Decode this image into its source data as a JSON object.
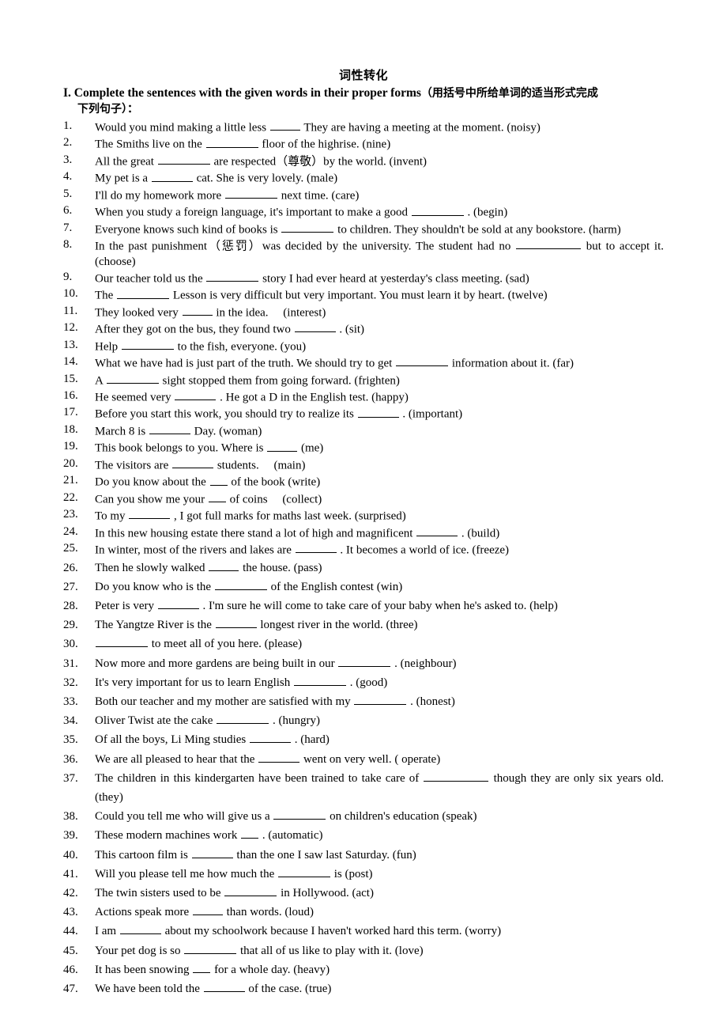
{
  "document": {
    "title": "词性转化",
    "section_heading": {
      "number": "I.",
      "english": "Complete the sentences with the given words in their proper forms",
      "chinese_line1": "（用括号中所给单词的适当形式完成",
      "chinese_line2": "下列句子）："
    }
  },
  "questions": [
    {
      "num": "1.",
      "pre": "Would you mind making a little less",
      "blank": "b-s",
      "post": "They are having a meeting at the moment. (noisy)",
      "justify": false
    },
    {
      "num": "2.",
      "pre": "The Smiths live on the",
      "blank": "b-l",
      "post": "floor of the highrise. (nine)",
      "justify": false
    },
    {
      "num": "3.",
      "pre": "All the great",
      "blank": "b-l",
      "post": "are respected（尊敬）by the world. (invent)",
      "justify": false
    },
    {
      "num": "4.",
      "pre": "My pet is a",
      "blank": "b-m",
      "post": "cat. She is very lovely. (male)",
      "justify": false
    },
    {
      "num": "5.",
      "pre": "I'll do my homework more",
      "blank": "b-l",
      "post": "next time. (care)",
      "justify": false
    },
    {
      "num": "6.",
      "pre": "When you study a foreign language, it's important to make a good",
      "blank": "b-l",
      "post": ". (begin)",
      "justify": false
    },
    {
      "num": "7.",
      "pre": "Everyone knows such kind of books is",
      "blank": "b-l",
      "post": "to children. They shouldn't be sold at any bookstore. (harm)",
      "justify": true
    },
    {
      "num": "8.",
      "pre": "In the past punishment（惩罚）was decided by the university. The student had no",
      "blank": "b-xl",
      "post": "but to accept it. (choose)",
      "justify": true
    },
    {
      "num": "9.",
      "pre": "Our teacher told us the",
      "blank": "b-l",
      "post": "story I had ever heard at yesterday's class meeting. (sad)",
      "justify": false
    },
    {
      "num": "10.",
      "pre": "The",
      "blank": "b-l",
      "post": "Lesson is very difficult but very important. You must learn it by heart. (twelve)",
      "justify": false
    },
    {
      "num": "11.",
      "pre": "They looked very",
      "blank": "b-s",
      "post": "in the idea.　 (interest)",
      "justify": false
    },
    {
      "num": "12.",
      "pre": "After they got on the bus, they found two",
      "blank": "b-m",
      "post": ". (sit)",
      "justify": false
    },
    {
      "num": "13.",
      "pre": "Help",
      "blank": "b-l",
      "post": "to the fish, everyone. (you)",
      "justify": false
    },
    {
      "num": "14.",
      "pre": "What we have had is just part of the truth. We should try to get",
      "blank": "b-l",
      "post": "information about it. (far)",
      "justify": false
    },
    {
      "num": "15.",
      "pre": "A",
      "blank": "b-l",
      "post": "sight stopped them from going forward. (frighten)",
      "justify": false
    },
    {
      "num": "16.",
      "pre": "He seemed very",
      "blank": "b-m",
      "post": ". He got a D in the English test. (happy)",
      "justify": false
    },
    {
      "num": "17.",
      "pre": "Before you start this work, you should try to realize its",
      "blank": "b-m",
      "post": ". (important)",
      "justify": false
    },
    {
      "num": "18.",
      "pre": "March 8 is",
      "blank": "b-m",
      "post": "Day. (woman)",
      "justify": false
    },
    {
      "num": "19.",
      "pre": "This book belongs to you. Where is",
      "blank": "b-s",
      "post": "(me)",
      "justify": false
    },
    {
      "num": "20.",
      "pre": "The visitors are",
      "blank": "b-m",
      "post": "students.　 (main)",
      "justify": false
    },
    {
      "num": "21.",
      "pre": "Do you know about the",
      "blank": "b-xs",
      "post": "of the book (write)",
      "justify": false
    },
    {
      "num": "22.",
      "pre": "Can you show me your",
      "blank": "b-xs",
      "post": "of coins　 (collect)",
      "justify": false
    },
    {
      "num": "23.",
      "pre": "To my",
      "blank": "b-m",
      "post": ", I got full marks for maths last week. (surprised)",
      "justify": false
    },
    {
      "num": "24.",
      "pre": "In this new housing estate there stand a lot of high and magnificent",
      "blank": "b-m",
      "post": ". (build)",
      "justify": false
    },
    {
      "num": "25.",
      "pre": "In winter, most of the rivers and lakes are",
      "blank": "b-m",
      "post": ". It becomes a world of ice. (freeze)",
      "justify": false
    },
    {
      "num": "26.",
      "pre": "Then he slowly walked",
      "blank": "b-s",
      "post": "the house. (pass)",
      "justify": false
    },
    {
      "num": "27.",
      "pre": "Do you know who is the",
      "blank": "b-l",
      "post": "of the English contest (win)",
      "justify": false
    },
    {
      "num": "28.",
      "pre": "Peter is very",
      "blank": "b-m",
      "post": ". I'm sure he will come to take care of your baby when he's asked to. (help)",
      "justify": false
    },
    {
      "num": "29.",
      "pre": "The Yangtze River is the",
      "blank": "b-m",
      "post": "longest river in the world. (three)",
      "justify": false
    },
    {
      "num": "30.",
      "pre": "",
      "blank": "b-l",
      "post": "to meet all of you here. (please)",
      "justify": false
    },
    {
      "num": "31.",
      "pre": "Now more and more gardens are being built in our",
      "blank": "b-l",
      "post": ". (neighbour)",
      "justify": false
    },
    {
      "num": "32.",
      "pre": "It's very important for us to learn English",
      "blank": "b-l",
      "post": ". (good)",
      "justify": false
    },
    {
      "num": "33.",
      "pre": "Both our teacher and my mother are satisfied with my",
      "blank": "b-l",
      "post": ". (honest)",
      "justify": false
    },
    {
      "num": "34.",
      "pre": "Oliver Twist ate the cake",
      "blank": "b-l",
      "post": ". (hungry)",
      "justify": false
    },
    {
      "num": "35.",
      "pre": "Of all the boys, Li Ming studies",
      "blank": "b-m",
      "post": ". (hard)",
      "justify": false
    },
    {
      "num": "36.",
      "pre": "We are all pleased to hear that the",
      "blank": "b-m",
      "post": "went on very well. ( operate)",
      "justify": false
    },
    {
      "num": "37.",
      "pre": "The children in this kindergarten have been trained to take care of",
      "blank": "b-xl",
      "post": "though they are only six years old. (they)",
      "justify": true
    },
    {
      "num": "38.",
      "pre": "Could you tell me who will give us a",
      "blank": "b-l",
      "post": "on children's education (speak)",
      "justify": false
    },
    {
      "num": "39.",
      "pre": "These modern machines work",
      "blank": "b-xs",
      "post": ". (automatic)",
      "justify": false
    },
    {
      "num": "40.",
      "pre": "This cartoon film is",
      "blank": "b-m",
      "post": "than the one I saw last Saturday. (fun)",
      "justify": false
    },
    {
      "num": "41.",
      "pre": "Will you please tell me how much the",
      "blank": "b-l",
      "post": "is (post)",
      "justify": false
    },
    {
      "num": "42.",
      "pre": "The twin sisters used to be",
      "blank": "b-l",
      "post": "in Hollywood. (act)",
      "justify": false
    },
    {
      "num": "43.",
      "pre": "Actions speak more",
      "blank": "b-s",
      "post": "than words. (loud)",
      "justify": false
    },
    {
      "num": "44.",
      "pre": "I am",
      "blank": "b-m",
      "post": "about my schoolwork because I haven't worked hard this term. (worry)",
      "justify": false
    },
    {
      "num": "45.",
      "pre": "Your pet dog is so",
      "blank": "b-l",
      "post": "that all of us like to play with it. (love)",
      "justify": false
    },
    {
      "num": "46.",
      "pre": "It has been snowing",
      "blank": "b-xs",
      "post": "for a whole day. (heavy)",
      "justify": false
    },
    {
      "num": "47.",
      "pre": "We have been told the",
      "blank": "b-m",
      "post": "of the case. (true)",
      "justify": false
    }
  ],
  "layout": {
    "tight_count": 25
  }
}
